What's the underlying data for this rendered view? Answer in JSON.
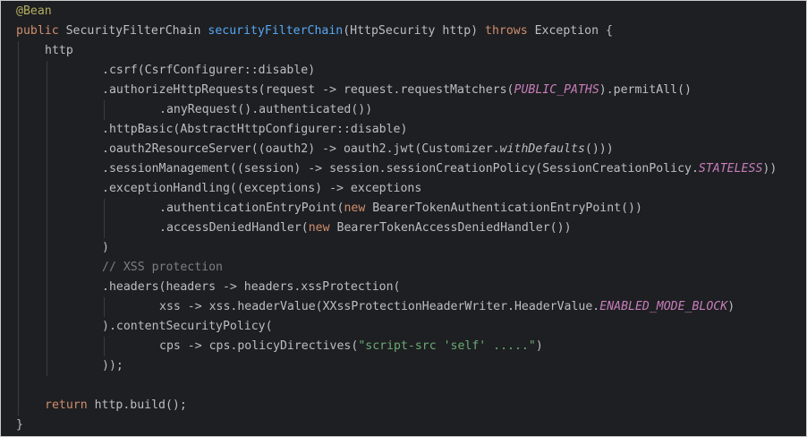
{
  "editor": {
    "lines": [
      {
        "tokens": [
          {
            "t": "@Bean",
            "c": "ann"
          }
        ]
      },
      {
        "tokens": [
          {
            "t": "public ",
            "c": "kw"
          },
          {
            "t": "SecurityFilterChain ",
            "c": "def"
          },
          {
            "t": "securityFilterChain",
            "c": "fn"
          },
          {
            "t": "(HttpSecurity http) ",
            "c": "def"
          },
          {
            "t": "throws ",
            "c": "kw"
          },
          {
            "t": "Exception {",
            "c": "def"
          }
        ]
      },
      {
        "tokens": [
          {
            "t": "http",
            "c": "def"
          }
        ]
      },
      {
        "tokens": [
          {
            "t": ".csrf(CsrfConfigurer::disable)",
            "c": "def"
          }
        ]
      },
      {
        "tokens": [
          {
            "t": ".authorizeHttpRequests(request -> request.requestMatchers(",
            "c": "def"
          },
          {
            "t": "PUBLIC_PATHS",
            "c": "con"
          },
          {
            "t": ").permitAll()",
            "c": "def"
          }
        ]
      },
      {
        "tokens": [
          {
            "t": ".anyRequest().authenticated())",
            "c": "def"
          }
        ]
      },
      {
        "tokens": [
          {
            "t": ".httpBasic(AbstractHttpConfigurer::disable)",
            "c": "def"
          }
        ]
      },
      {
        "tokens": [
          {
            "t": ".oauth2ResourceServer((oauth2) -> oauth2.jwt(Customizer.",
            "c": "def"
          },
          {
            "t": "withDefaults",
            "c": "sm"
          },
          {
            "t": "()))",
            "c": "def"
          }
        ]
      },
      {
        "tokens": [
          {
            "t": ".sessionManagement((session) -> session.sessionCreationPolicy(SessionCreationPolicy.",
            "c": "def"
          },
          {
            "t": "STATELESS",
            "c": "con"
          },
          {
            "t": "))",
            "c": "def"
          }
        ]
      },
      {
        "tokens": [
          {
            "t": ".exceptionHandling((exceptions) -> exceptions",
            "c": "def"
          }
        ]
      },
      {
        "tokens": [
          {
            "t": ".authenticationEntryPoint(",
            "c": "def"
          },
          {
            "t": "new ",
            "c": "kw"
          },
          {
            "t": "BearerTokenAuthenticationEntryPoint())",
            "c": "def"
          }
        ]
      },
      {
        "tokens": [
          {
            "t": ".accessDeniedHandler(",
            "c": "def"
          },
          {
            "t": "new ",
            "c": "kw"
          },
          {
            "t": "BearerTokenAccessDeniedHandler())",
            "c": "def"
          }
        ]
      },
      {
        "tokens": [
          {
            "t": ")",
            "c": "def"
          }
        ]
      },
      {
        "tokens": [
          {
            "t": "// XSS protection",
            "c": "cm"
          }
        ]
      },
      {
        "tokens": [
          {
            "t": ".headers(headers -> headers.xssProtection(",
            "c": "def"
          }
        ]
      },
      {
        "tokens": [
          {
            "t": "xss -> xss.headerValue(XXssProtectionHeaderWriter.HeaderValue.",
            "c": "def"
          },
          {
            "t": "ENABLED_MODE_BLOCK",
            "c": "con"
          },
          {
            "t": ")",
            "c": "def"
          }
        ]
      },
      {
        "tokens": [
          {
            "t": ").contentSecurityPolicy(",
            "c": "def"
          }
        ]
      },
      {
        "tokens": [
          {
            "t": "cps -> cps.policyDirectives(",
            "c": "def"
          },
          {
            "t": "\"script-src 'self' .....\"",
            "c": "str"
          },
          {
            "t": ")",
            "c": "def"
          }
        ]
      },
      {
        "tokens": [
          {
            "t": "));",
            "c": "def"
          }
        ]
      },
      {
        "tokens": []
      },
      {
        "tokens": [
          {
            "t": "return ",
            "c": "kw"
          },
          {
            "t": "http.build();",
            "c": "def"
          }
        ]
      },
      {
        "tokens": [
          {
            "t": "}",
            "c": "def"
          }
        ]
      }
    ]
  }
}
